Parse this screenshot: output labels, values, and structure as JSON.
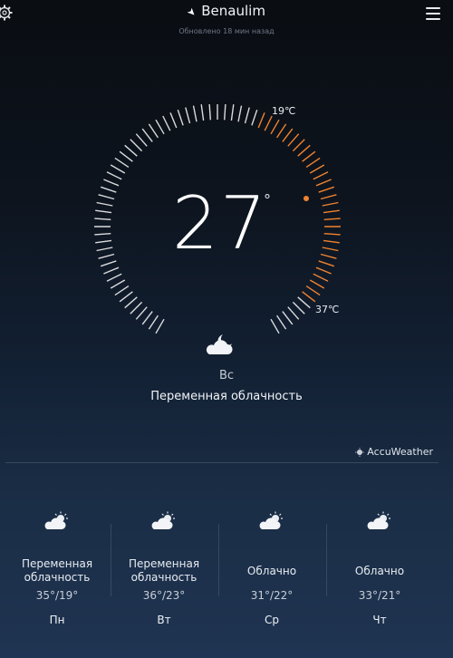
{
  "header": {
    "location": "Benaulim",
    "updated": "Обновлено 18 мин назад",
    "location_icon": "location-arrow-icon",
    "settings_icon": "gear-icon",
    "menu_icon": "hamburger-menu-icon"
  },
  "current": {
    "temperature": "27",
    "degree": "°",
    "min_label": "19℃",
    "max_label": "37℃",
    "day": "Вс",
    "condition": "Переменная облачность",
    "icon": "cloud-moon-icon"
  },
  "provider": {
    "label": "AccuWeather",
    "icon": "accuweather-sun-icon"
  },
  "colors": {
    "accent": "#f0832f",
    "text": "#ffffff"
  },
  "forecast": [
    {
      "condition": "Переменная облачность",
      "range": "35°/19°",
      "day": "Пн",
      "icon": "cloud-sun-icon"
    },
    {
      "condition": "Переменная облачность",
      "range": "36°/23°",
      "day": "Вт",
      "icon": "cloud-sun-icon"
    },
    {
      "condition": "Облачно",
      "range": "31°/22°",
      "day": "Ср",
      "icon": "cloud-sun-icon"
    },
    {
      "condition": "Облачно",
      "range": "33°/21°",
      "day": "Чт",
      "icon": "cloud-sun-icon"
    }
  ]
}
